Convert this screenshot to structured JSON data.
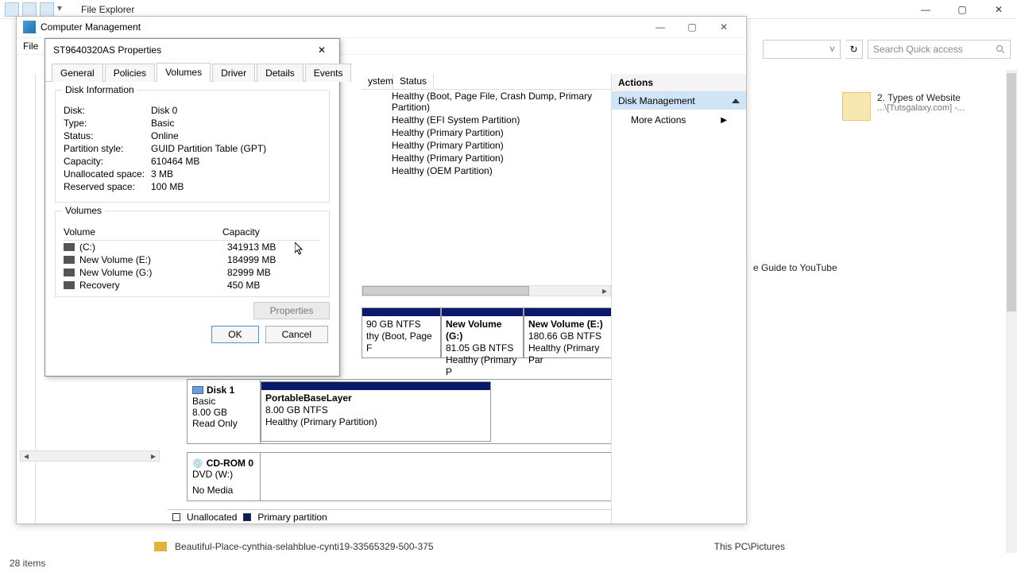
{
  "explorer": {
    "title": "File Explorer",
    "search_placeholder": "Search Quick access",
    "item": {
      "name": "2. Types of Website",
      "sub": "...\\[Tutsgalaxy.com] -..."
    },
    "label2": "e Guide to YouTube",
    "status": "28 items",
    "selected_name": "Beautiful-Place-cynthia-selahblue-cynti19-33565329-500-375",
    "selected_loc": "This PC\\Pictures"
  },
  "cm": {
    "title": "Computer Management",
    "menu": [
      "File"
    ],
    "vol_header": {
      "c1": "ystem",
      "c2": "Status"
    },
    "vol_status": [
      "Healthy (Boot, Page File, Crash Dump, Primary Partition)",
      "Healthy (EFI System Partition)",
      "Healthy (Primary Partition)",
      "Healthy (Primary Partition)",
      "Healthy (Primary Partition)",
      "Healthy (OEM Partition)"
    ],
    "actions": {
      "header": "Actions",
      "selected": "Disk Management",
      "more": "More Actions"
    },
    "disk0_parts": [
      {
        "name": "",
        "fs": "90 GB NTFS",
        "status": "thy (Boot, Page F"
      },
      {
        "name": "New Volume  (G:)",
        "fs": "81.05 GB NTFS",
        "status": "Healthy (Primary P"
      },
      {
        "name": "New Volume  (E:)",
        "fs": "180.66 GB NTFS",
        "status": "Healthy (Primary Par"
      }
    ],
    "disk1": {
      "label": "Disk 1",
      "type": "Basic",
      "size": "8.00 GB",
      "mode": "Read Only",
      "part": {
        "name": "PortableBaseLayer",
        "fs": "8.00 GB NTFS",
        "status": "Healthy (Primary Partition)"
      }
    },
    "cdrom": {
      "label": "CD-ROM 0",
      "drive": "DVD (W:)",
      "state": "No Media"
    },
    "legend": {
      "unalloc": "Unallocated",
      "primary": "Primary partition"
    }
  },
  "props": {
    "title": "ST9640320AS Properties",
    "tabs": [
      "General",
      "Policies",
      "Volumes",
      "Driver",
      "Details",
      "Events"
    ],
    "active_tab": 2,
    "group1_title": "Disk Information",
    "info": [
      {
        "k": "Disk:",
        "v": "Disk 0"
      },
      {
        "k": "Type:",
        "v": "Basic"
      },
      {
        "k": "Status:",
        "v": "Online"
      },
      {
        "k": "Partition style:",
        "v": "GUID Partition Table (GPT)"
      },
      {
        "k": "Capacity:",
        "v": "610464 MB"
      },
      {
        "k": "Unallocated space:",
        "v": "3 MB"
      },
      {
        "k": "Reserved space:",
        "v": "100 MB"
      }
    ],
    "group2_title": "Volumes",
    "vol_head": {
      "c1": "Volume",
      "c2": "Capacity"
    },
    "volumes": [
      {
        "name": "(C:)",
        "cap": "341913 MB"
      },
      {
        "name": "New Volume (E:)",
        "cap": "184999 MB"
      },
      {
        "name": "New Volume (G:)",
        "cap": "82999 MB"
      },
      {
        "name": "Recovery",
        "cap": "450 MB"
      }
    ],
    "props_btn": "Properties",
    "ok": "OK",
    "cancel": "Cancel"
  }
}
